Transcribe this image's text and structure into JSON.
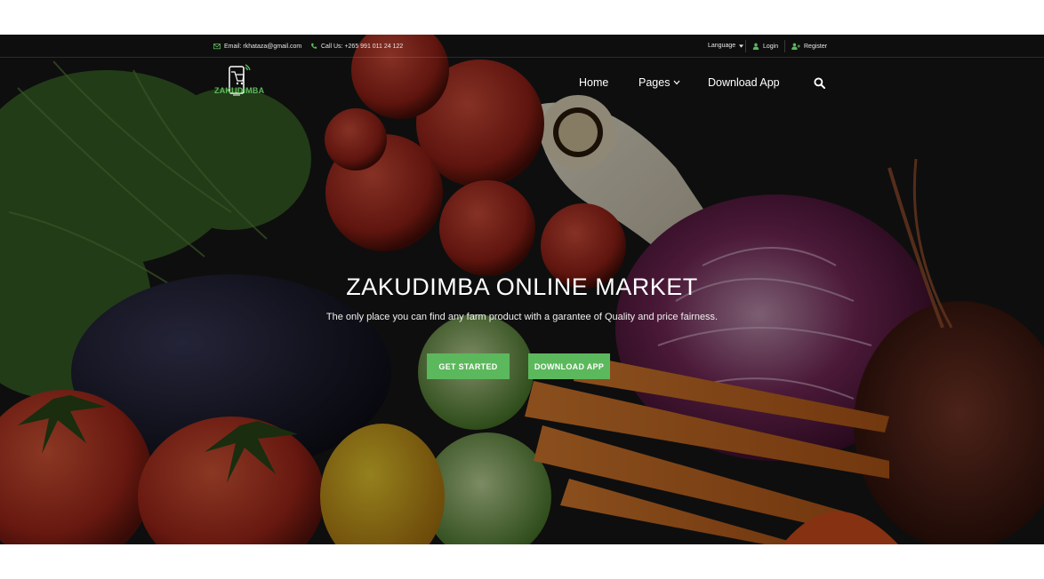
{
  "topbar": {
    "email": "Email: rkhataza@gmail.com",
    "phone": "Call Us: +265 991 011 24 122",
    "language": "Language",
    "login": "Login",
    "register": "Register"
  },
  "brand": {
    "name": "ZAKUDIMBA"
  },
  "nav": {
    "home": "Home",
    "pages": "Pages",
    "download": "Download App"
  },
  "hero": {
    "title": "ZAKUDIMBA ONLINE MARKET",
    "subtitle": "The only place you can find any farm product with a garantee of Quality and price fairness.",
    "btn_start": "GET STARTED",
    "btn_download": "DOWNLOAD APP"
  },
  "colors": {
    "accent": "#5cb85c",
    "topbar_text": "#e8e8e8",
    "background_dark": "#1a1a1a"
  },
  "icons": [
    "envelope-icon",
    "phone-icon",
    "caret-down-icon",
    "user-icon",
    "user-plus-icon",
    "logo-cart-icon",
    "chevron-down-icon",
    "search-icon"
  ]
}
